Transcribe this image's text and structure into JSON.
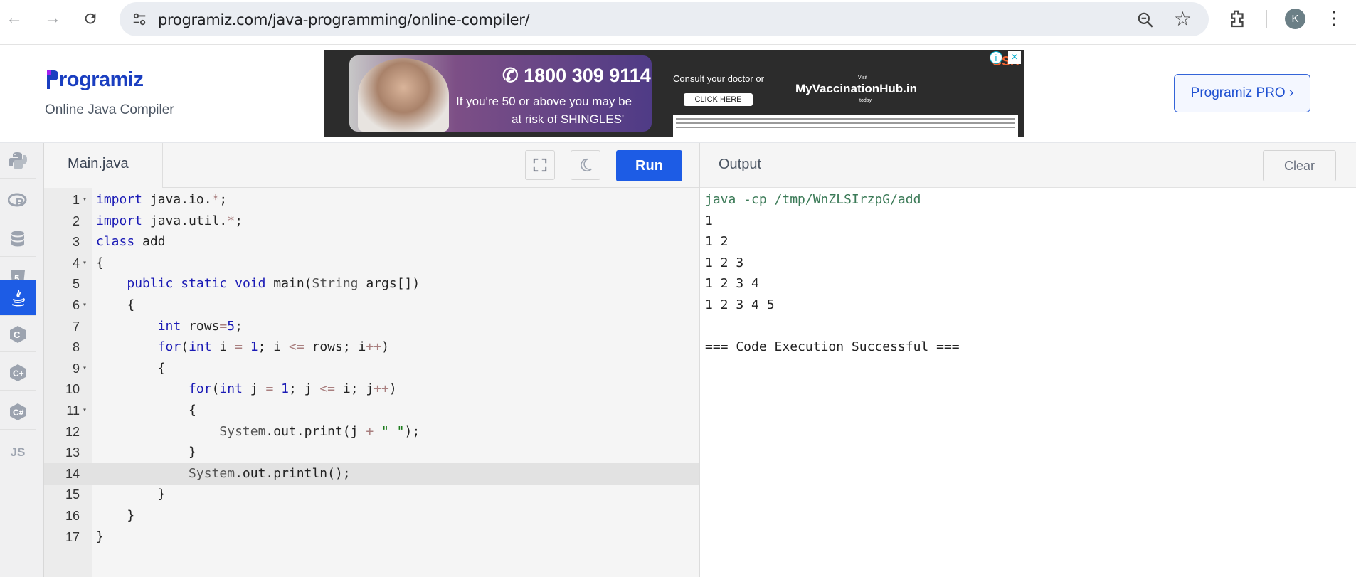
{
  "browser": {
    "url": "programiz.com/java-programming/online-compiler/",
    "profile_initial": "K"
  },
  "header": {
    "logo_text": "rogramiz",
    "subtitle": "Online Java Compiler",
    "pro_button": "Programiz PRO ›"
  },
  "ad": {
    "phone": "1800 309 9114",
    "line1": "If you're 50 or above you may be",
    "line2": "at risk of SHINGLES'",
    "consult": "Consult your doctor or",
    "click": "CLICK HERE",
    "brand": "MyVaccinationHub.in",
    "visit": "Visit",
    "today": "today",
    "sponsor": "GSK"
  },
  "editor": {
    "file_tab": "Main.java",
    "run_label": "Run",
    "lines": [
      {
        "n": "1",
        "fold": true,
        "html": "<span class='kw'>import</span> java.io.<span class='op'>*</span>;"
      },
      {
        "n": "2",
        "fold": false,
        "html": "<span class='kw'>import</span> java.util.<span class='op'>*</span>;"
      },
      {
        "n": "3",
        "fold": false,
        "html": "<span class='kw'>class</span> add"
      },
      {
        "n": "4",
        "fold": true,
        "html": "{"
      },
      {
        "n": "5",
        "fold": false,
        "html": "    <span class='kw'>public</span> <span class='kw'>static</span> <span class='kw'>void</span> main(<span class='cls'>String</span> args[])"
      },
      {
        "n": "6",
        "fold": true,
        "html": "    {"
      },
      {
        "n": "7",
        "fold": false,
        "html": "        <span class='kw'>int</span> rows<span class='op'>=</span><span class='num'>5</span>;"
      },
      {
        "n": "8",
        "fold": false,
        "html": "        <span class='kw'>for</span>(<span class='kw'>int</span> i <span class='op'>=</span> <span class='num'>1</span>; i <span class='op'>&lt;=</span> rows; i<span class='op'>++</span>)"
      },
      {
        "n": "9",
        "fold": true,
        "html": "        {"
      },
      {
        "n": "10",
        "fold": false,
        "html": "            <span class='kw'>for</span>(<span class='kw'>int</span> j <span class='op'>=</span> <span class='num'>1</span>; j <span class='op'>&lt;=</span> i; j<span class='op'>++</span>)"
      },
      {
        "n": "11",
        "fold": true,
        "html": "            {"
      },
      {
        "n": "12",
        "fold": false,
        "html": "                <span class='cls'>System</span>.out.print(j <span class='op'>+</span> <span class='str'>\" \"</span>);"
      },
      {
        "n": "13",
        "fold": false,
        "html": "            }"
      },
      {
        "n": "14",
        "fold": false,
        "html": "            <span class='cls'>System</span>.out.println();"
      },
      {
        "n": "15",
        "fold": false,
        "html": "        }"
      },
      {
        "n": "16",
        "fold": false,
        "html": "    }"
      },
      {
        "n": "17",
        "fold": false,
        "html": "}"
      }
    ],
    "active_line": "14"
  },
  "output": {
    "title": "Output",
    "clear_label": "Clear",
    "lines": [
      "java -cp /tmp/WnZLSIrzpG/add",
      "1",
      "1 2",
      "1 2 3",
      "1 2 3 4",
      "1 2 3 4 5",
      "",
      "=== Code Execution Successful ==="
    ]
  },
  "sidebar": {
    "items": [
      {
        "name": "python",
        "active": false
      },
      {
        "name": "r",
        "active": false
      },
      {
        "name": "sql",
        "active": false
      },
      {
        "name": "html",
        "active": false
      },
      {
        "name": "java",
        "active": true
      },
      {
        "name": "c",
        "active": false
      },
      {
        "name": "cpp",
        "active": false
      },
      {
        "name": "csharp",
        "active": false
      },
      {
        "name": "js",
        "label": "JS",
        "active": false
      }
    ]
  },
  "colors": {
    "accent": "#1d5ce5",
    "logo": "#1a3ec0"
  }
}
